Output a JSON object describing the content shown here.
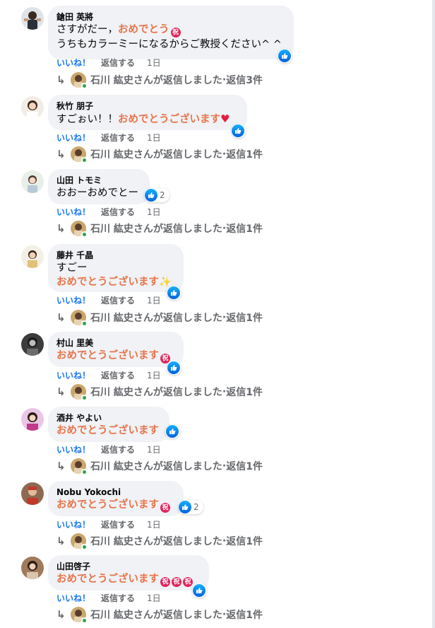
{
  "labels": {
    "like": "いいね！",
    "reply": "返信する",
    "replied": "石川 紘史さんが返信しました",
    "separator": " · "
  },
  "colors": {
    "accent": "#e8734a",
    "like_blue": "#1877f2",
    "bubble": "#f0f2f5",
    "muted": "#65676b",
    "online": "#31a24c"
  },
  "icons": [
    "avatar",
    "like-icon",
    "celebrate-icon",
    "heart-icon",
    "sparkle-icon",
    "reply-arrow-icon",
    "online-dot"
  ],
  "comments": [
    {
      "author": "鎗田 英將",
      "line1_plain": "さすがだー，",
      "line1_accent": "おめでとう",
      "line2": "うちもカラーミーになるからご教授ください^ ^",
      "time": "1日",
      "reply_count": "返信3件"
    },
    {
      "author": "秋竹 朋子",
      "plain": "すごぉい！！",
      "accent": "おめでとうございます",
      "time": "1日",
      "reply_count": "返信1件"
    },
    {
      "author": "山田 トモミ",
      "plain": "おおーおめでとー",
      "reaction_count": "2",
      "time": "1日",
      "reply_count": "返信1件"
    },
    {
      "author": "藤井 千晶",
      "line1": "すごー",
      "accent": "おめでとうございます",
      "time": "1日",
      "reply_count": "返信1件"
    },
    {
      "author": "村山 里美",
      "accent": "おめでとうございます",
      "time": "1日",
      "reply_count": "返信1件"
    },
    {
      "author": "酒井 やよい",
      "accent": "おめでとうございます",
      "time": "1日",
      "reply_count": "返信1件"
    },
    {
      "author": "Nobu Yokochi",
      "accent": "おめでとうございます",
      "reaction_count": "2",
      "time": "1日",
      "reply_count": "返信1件"
    },
    {
      "author": "山田啓子",
      "accent": "おめでとうございます",
      "time": "1日",
      "reply_count": "返信1件"
    }
  ]
}
